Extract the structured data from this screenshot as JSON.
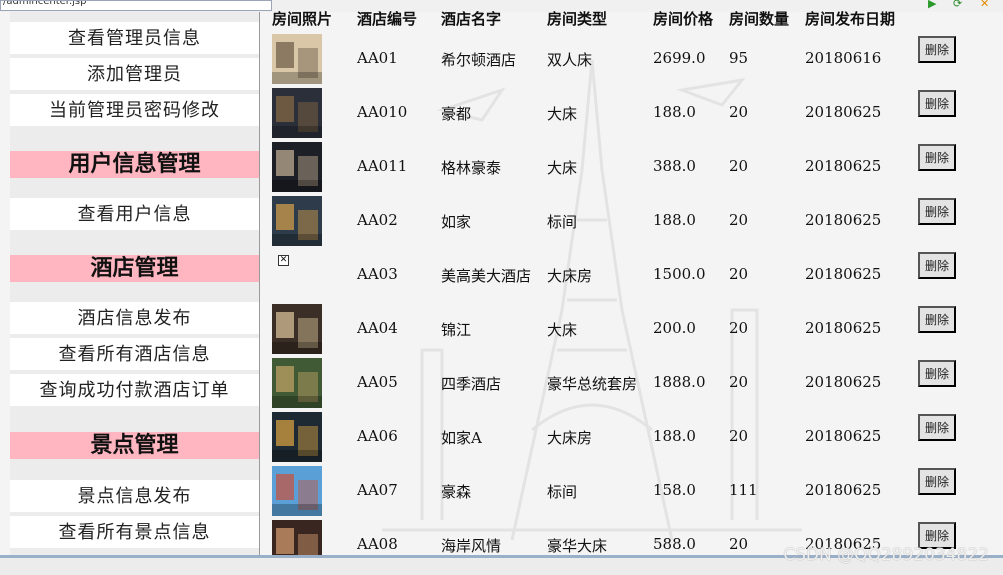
{
  "address_bar": "/admincenter.jsp",
  "sidebar": {
    "admin_links": [
      "查看管理员信息",
      "添加管理员",
      "当前管理员密码修改"
    ],
    "sections": [
      {
        "title": "用户信息管理",
        "links": [
          "查看用户信息"
        ]
      },
      {
        "title": "酒店管理",
        "links": [
          "酒店信息发布",
          "查看所有酒店信息",
          "查询成功付款酒店订单"
        ]
      },
      {
        "title": "景点管理",
        "links": [
          "景点信息发布",
          "查看所有景点信息"
        ]
      }
    ]
  },
  "table": {
    "headers": [
      "房间照片",
      "酒店编号",
      "酒店名字",
      "房间类型",
      "房间价格",
      "房间数量",
      "房间发布日期"
    ],
    "delete_label": "删除",
    "rows": [
      {
        "id": "AA01",
        "name": "希尔顿酒店",
        "type": "双人床",
        "price": "2699.0",
        "qty": "95",
        "date": "20180616",
        "photo": true
      },
      {
        "id": "AA010",
        "name": "豪都",
        "type": "大床",
        "price": "188.0",
        "qty": "20",
        "date": "20180625",
        "photo": true
      },
      {
        "id": "AA011",
        "name": "格林豪泰",
        "type": "大床",
        "price": "388.0",
        "qty": "20",
        "date": "20180625",
        "photo": true
      },
      {
        "id": "AA02",
        "name": "如家",
        "type": "标间",
        "price": "188.0",
        "qty": "20",
        "date": "20180625",
        "photo": true
      },
      {
        "id": "AA03",
        "name": "美高美大酒店",
        "type": "大床房",
        "price": "1500.0",
        "qty": "20",
        "date": "20180625",
        "photo": false
      },
      {
        "id": "AA04",
        "name": "锦江",
        "type": "大床",
        "price": "200.0",
        "qty": "20",
        "date": "20180625",
        "photo": true
      },
      {
        "id": "AA05",
        "name": "四季酒店",
        "type": "豪华总统套房",
        "price": "1888.0",
        "qty": "20",
        "date": "20180625",
        "photo": true
      },
      {
        "id": "AA06",
        "name": "如家A",
        "type": "大床房",
        "price": "188.0",
        "qty": "20",
        "date": "20180625",
        "photo": true
      },
      {
        "id": "AA07",
        "name": "豪森",
        "type": "标间",
        "price": "158.0",
        "qty": "111",
        "date": "20180625",
        "photo": true
      },
      {
        "id": "AA08",
        "name": "海岸风情",
        "type": "豪华大床",
        "price": "588.0",
        "qty": "20",
        "date": "20180625",
        "photo": true
      }
    ]
  },
  "watermark_text": "CSDN @QQ2892034822",
  "colors": {
    "section_header": "#ffb6c1",
    "sidebar_bg": "#ececec",
    "page_bg": "#f4f4f4"
  },
  "photo_themes": [
    [
      "#d9c7a8",
      "#6b5a44"
    ],
    [
      "#2b2f3a",
      "#8a6a44"
    ],
    [
      "#1d1f26",
      "#c9b497"
    ],
    [
      "#2e3b4a",
      "#d9a24a"
    ],
    null,
    [
      "#3a2e26",
      "#e0c9a0"
    ],
    [
      "#3f5a34",
      "#c7a56a"
    ],
    [
      "#1e2a33",
      "#e0a642"
    ],
    [
      "#5aa0d6",
      "#c94f3a"
    ],
    [
      "#3a2620",
      "#d8a070"
    ]
  ]
}
